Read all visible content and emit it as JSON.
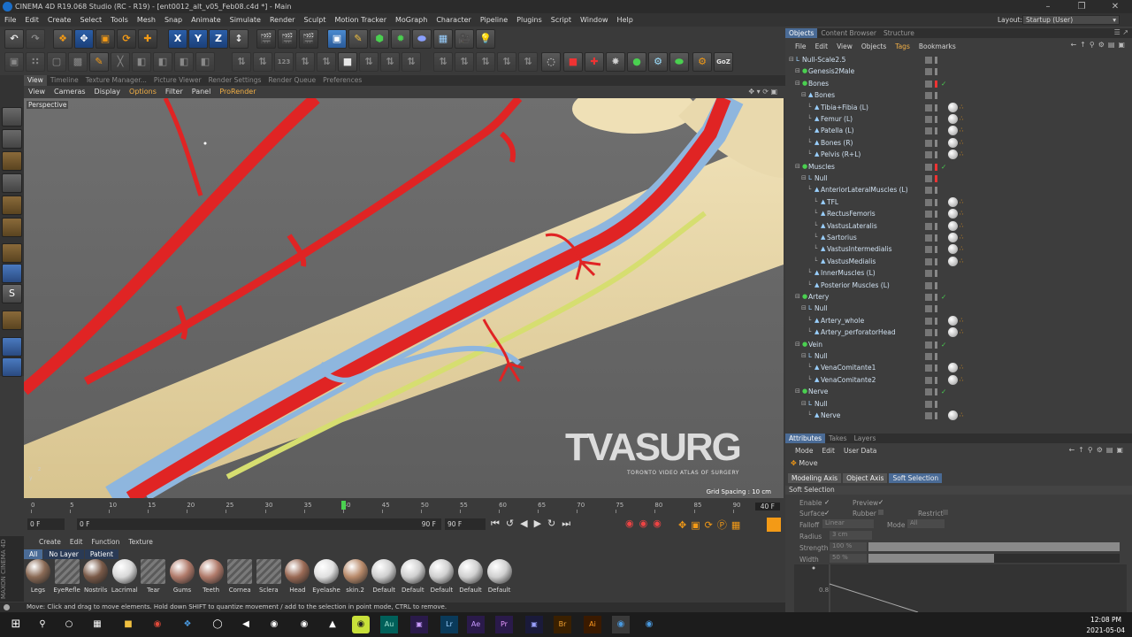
{
  "window": {
    "title": "CINEMA 4D R19.068 Studio (RC - R19) - [ent0012_alt_v05_Feb08.c4d *] - Main"
  },
  "menu": [
    "File",
    "Edit",
    "Create",
    "Select",
    "Tools",
    "Mesh",
    "Snap",
    "Animate",
    "Simulate",
    "Render",
    "Sculpt",
    "Motion Tracker",
    "MoGraph",
    "Character",
    "Pipeline",
    "Plugins",
    "Script",
    "Window",
    "Help"
  ],
  "layout": {
    "label": "Layout:",
    "value": "Startup (User)"
  },
  "view_tabs": [
    "View",
    "Timeline",
    "Texture Manager...",
    "Picture Viewer",
    "Render Settings",
    "Render Queue",
    "Preferences"
  ],
  "view_menu": [
    "View",
    "Cameras",
    "Display",
    "Options",
    "Filter",
    "Panel",
    "ProRender"
  ],
  "viewport": {
    "label": "Perspective",
    "grid_spacing": "Grid Spacing : 10 cm",
    "watermark_main": "TVASURG",
    "watermark_sub": "TORONTO VIDEO ATLAS OF SURGERY"
  },
  "timeline": {
    "ticks": [
      "0",
      "5",
      "10",
      "15",
      "20",
      "25",
      "30",
      "35",
      "40",
      "45",
      "50",
      "55",
      "60",
      "65",
      "70",
      "75",
      "80",
      "85",
      "90"
    ],
    "current_frame": "40 F",
    "playhead": 0.444
  },
  "transport": {
    "start": "0 F",
    "range_start": "0 F",
    "range_end": "90 F",
    "end": "90 F"
  },
  "materials": {
    "menu": [
      "Create",
      "Edit",
      "Function",
      "Texture"
    ],
    "filters": [
      "All",
      "No Layer",
      "Patient"
    ],
    "items": [
      {
        "name": "Legs",
        "color": "#8a6a55"
      },
      {
        "name": "EyeRefle",
        "color": "#hatch"
      },
      {
        "name": "Nostrils",
        "color": "#7a5a48"
      },
      {
        "name": "Lacrimal",
        "color": "#d8d8d8"
      },
      {
        "name": "Tear",
        "color": "#hatch"
      },
      {
        "name": "Gums",
        "color": "#b07a6a"
      },
      {
        "name": "Teeth",
        "color": "#b07a6a"
      },
      {
        "name": "Cornea",
        "color": "#hatch"
      },
      {
        "name": "Sclera",
        "color": "#hatch"
      },
      {
        "name": "Head",
        "color": "#9a6a55"
      },
      {
        "name": "Eyelashe",
        "color": "#e0e0e0"
      },
      {
        "name": "skin.2",
        "color": "#b88a6a"
      },
      {
        "name": "Default",
        "color": "#d0d0d0"
      },
      {
        "name": "Default",
        "color": "#d0d0d0"
      },
      {
        "name": "Default",
        "color": "#d0d0d0"
      },
      {
        "name": "Default",
        "color": "#d0d0d0"
      },
      {
        "name": "Default",
        "color": "#d0d0d0"
      }
    ]
  },
  "status": "Move: Click and drag to move elements. Hold down SHIFT to quantize movement / add to the selection in point mode, CTRL to remove.",
  "objects_panel": {
    "tabs": [
      "Objects",
      "Content Browser",
      "Structure"
    ],
    "menu": [
      "File",
      "Edit",
      "View",
      "Objects",
      "Tags",
      "Bookmarks"
    ],
    "rows": [
      {
        "name": "Null-Scale2.5",
        "indent": 0
      },
      {
        "name": "Genesis2Male",
        "indent": 1
      },
      {
        "name": "Bones",
        "indent": 1
      },
      {
        "name": "Bones",
        "indent": 2
      },
      {
        "name": "Tibia+Fibia (L)",
        "indent": 3
      },
      {
        "name": "Femur (L)",
        "indent": 3
      },
      {
        "name": "Patella (L)",
        "indent": 3
      },
      {
        "name": "Bones (R)",
        "indent": 3
      },
      {
        "name": "Pelvis (R+L)",
        "indent": 3
      },
      {
        "name": "Muscles",
        "indent": 1
      },
      {
        "name": "Null",
        "indent": 2
      },
      {
        "name": "AnteriorLateralMuscles (L)",
        "indent": 3
      },
      {
        "name": "TFL",
        "indent": 4
      },
      {
        "name": "RectusFemoris",
        "indent": 4
      },
      {
        "name": "VastusLateralis",
        "indent": 4
      },
      {
        "name": "Sartorius",
        "indent": 4
      },
      {
        "name": "VastusIntermedialis",
        "indent": 4
      },
      {
        "name": "VastusMedialis",
        "indent": 4
      },
      {
        "name": "InnerMuscles (L)",
        "indent": 3
      },
      {
        "name": "Posterior Muscles (L)",
        "indent": 3
      },
      {
        "name": "Artery",
        "indent": 1
      },
      {
        "name": "Null",
        "indent": 2
      },
      {
        "name": "Artery_whole",
        "indent": 3
      },
      {
        "name": "Artery_perforatorHead",
        "indent": 3
      },
      {
        "name": "Vein",
        "indent": 1
      },
      {
        "name": "Null",
        "indent": 2
      },
      {
        "name": "VenaComitante1",
        "indent": 3
      },
      {
        "name": "VenaComitante2",
        "indent": 3
      },
      {
        "name": "Nerve",
        "indent": 1
      },
      {
        "name": "Null",
        "indent": 2
      },
      {
        "name": "Nerve",
        "indent": 3
      }
    ]
  },
  "attributes_panel": {
    "tabs": [
      "Attributes",
      "Takes",
      "Layers"
    ],
    "menu": [
      "Mode",
      "Edit",
      "User Data"
    ],
    "tool": "Move",
    "subtabs": [
      "Modeling Axis",
      "Object Axis",
      "Soft Selection"
    ],
    "section": "Soft Selection",
    "labels": {
      "enable": "Enable",
      "preview": "Preview",
      "surface": "Surface",
      "rubber": "Rubber",
      "restrict": "Restrict",
      "falloff": "Falloff",
      "mode": "Mode",
      "radius": "Radius",
      "strength": "Strength",
      "width": "Width"
    },
    "values": {
      "falloff": "Linear",
      "mode": "All",
      "radius": "3 cm",
      "strength": "100 %",
      "width": "50 %",
      "graph_tick": "0.8"
    },
    "strength_level": 1.0,
    "width_level": 0.5
  },
  "taskbar": {
    "time": "12:08 PM",
    "date": "2021-05-04"
  }
}
